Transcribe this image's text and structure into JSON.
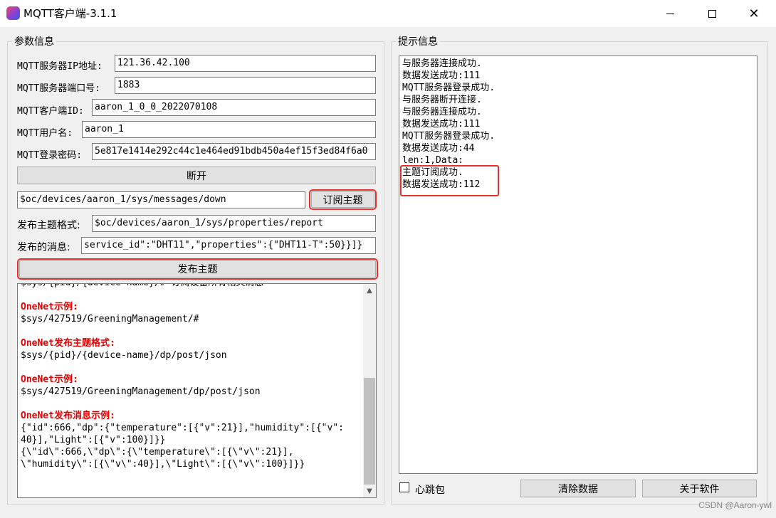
{
  "window": {
    "title": "MQTT客户端-3.1.1",
    "minimize": "—",
    "maximize": "☐",
    "close": "✕"
  },
  "params": {
    "legend": "参数信息",
    "ip_label": "MQTT服务器IP地址:",
    "ip_value": "121.36.42.100",
    "port_label": "MQTT服务器端口号:",
    "port_value": "1883",
    "client_id_label": "MQTT客户端ID:",
    "client_id_value": "aaron_1_0_0_2022070108",
    "username_label": "MQTT用户名:",
    "username_value": "aaron_1",
    "password_label": "MQTT登录密码:",
    "password_value": "5e817e1414e292c44c1e464ed91bdb450a4ef15f3ed84f6a0",
    "disconnect_button": "断开",
    "subscribe_topic_value": "$oc/devices/aaron_1/sys/messages/down",
    "subscribe_button": "订阅主题",
    "publish_format_label": "发布主题格式:",
    "publish_format_value": "$oc/devices/aaron_1/sys/properties/report",
    "publish_message_label": "发布的消息:",
    "publish_message_value": "service_id\":\"DHT11\",\"properties\":{\"DHT11-T\":50}}]}",
    "publish_button": "发布主题"
  },
  "notes": {
    "line0": "$sys/{pid}/{device-name}/#   订阅设备所有相关消息",
    "h1": "OneNet示例:",
    "l1": "$sys/427519/GreeningManagement/#",
    "h2": "OneNet发布主题格式:",
    "l2": "$sys/{pid}/{device-name}/dp/post/json",
    "h3": "OneNet示例:",
    "l3": "$sys/427519/GreeningManagement/dp/post/json",
    "h4": "OneNet发布消息示例:",
    "l4a": "{\"id\":666,\"dp\":{\"temperature\":[{\"v\":21}],\"humidity\":[{\"v\":",
    "l4b": "40}],\"Light\":[{\"v\":100}]}}",
    "l5a": "{\\\"id\\\":666,\\\"dp\\\":{\\\"temperature\\\":[{\\\"v\\\":21}],",
    "l5b": "\\\"humidity\\\":[{\\\"v\\\":40}],\\\"Light\\\":[{\\\"v\\\":100}]}}",
    "scroll_up": "▲",
    "scroll_down": "▼"
  },
  "hints": {
    "legend": "提示信息",
    "log": [
      "与服务器连接成功.",
      "数据发送成功:111",
      "MQTT服务器登录成功.",
      "与服务器断开连接.",
      "与服务器连接成功.",
      "数据发送成功:111",
      "MQTT服务器登录成功.",
      "数据发送成功:44",
      "len:1,Data:",
      "主题订阅成功.",
      "数据发送成功:112"
    ],
    "heartbeat_label": "心跳包",
    "clear_button": "清除数据",
    "about_button": "关于软件"
  },
  "footer": {
    "watermark": "CSDN @Aaron-ywl"
  },
  "colors": {
    "highlight": "#e8302a",
    "note_heading": "#e00000"
  }
}
